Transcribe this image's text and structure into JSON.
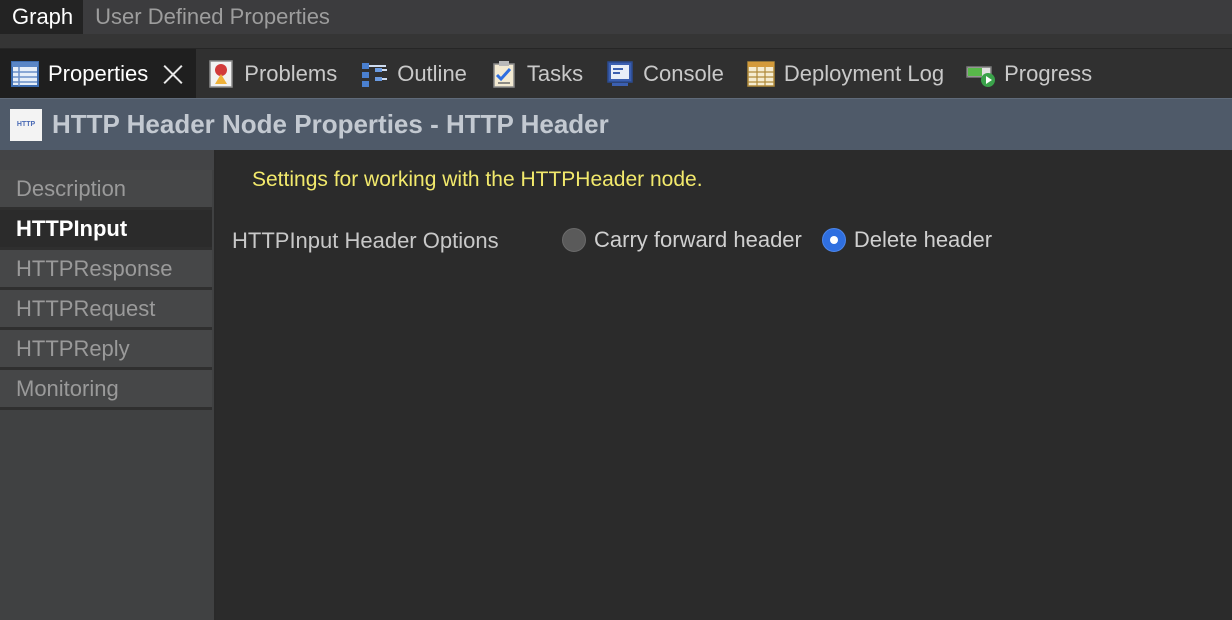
{
  "editor_tabs": [
    {
      "label": "Graph",
      "active": true
    },
    {
      "label": "User Defined Properties",
      "active": false
    }
  ],
  "view_tabs": [
    {
      "label": "Properties",
      "icon": "properties-table-icon",
      "active": true
    },
    {
      "label": "Problems",
      "icon": "problems-icon",
      "active": false
    },
    {
      "label": "Outline",
      "icon": "outline-icon",
      "active": false
    },
    {
      "label": "Tasks",
      "icon": "tasks-icon",
      "active": false
    },
    {
      "label": "Console",
      "icon": "console-icon",
      "active": false
    },
    {
      "label": "Deployment Log",
      "icon": "deployment-log-icon",
      "active": false
    },
    {
      "label": "Progress",
      "icon": "progress-icon",
      "active": false
    }
  ],
  "header": {
    "icon_text": "HTTP",
    "title": "HTTP Header Node Properties - HTTP Header"
  },
  "sidebar": {
    "items": [
      {
        "label": "Description",
        "active": false
      },
      {
        "label": "HTTPInput",
        "active": true
      },
      {
        "label": "HTTPResponse",
        "active": false
      },
      {
        "label": "HTTPRequest",
        "active": false
      },
      {
        "label": "HTTPReply",
        "active": false
      },
      {
        "label": "Monitoring",
        "active": false
      }
    ]
  },
  "main": {
    "description": "Settings for working with the HTTPHeader node.",
    "option_label": "HTTPInput Header Options",
    "radio_options": [
      {
        "label": "Carry forward header",
        "selected": false
      },
      {
        "label": "Delete header",
        "selected": true
      }
    ]
  },
  "colors": {
    "accent": "#2f6fe0",
    "description_text": "#f2e96c",
    "header_bg": "#4f5a69"
  }
}
